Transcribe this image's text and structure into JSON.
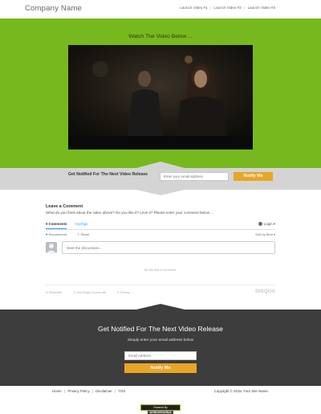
{
  "header": {
    "company_name": "Company Name",
    "nav": [
      "Launch Video #1",
      "Launch Video #2",
      "Launch Video #3"
    ],
    "separator": "|"
  },
  "hero": {
    "title": "Watch The Video Below ...",
    "background_color": "#77b81e"
  },
  "notify_band": {
    "text": "Get Notified For The Next Video Release",
    "email_placeholder": "Enter your email address",
    "button_label": "Notify Me",
    "button_color": "#e8a526"
  },
  "comments": {
    "title": "Leave a Comment",
    "subtitle": "What do you think about the video above? Do you like it? Love it? Please enter your comment below ...",
    "tab_comments": "0 Comments",
    "tab_site": "AnyDigs",
    "login": "Login",
    "recommend": "Recommend",
    "share": "Share",
    "sort": "Sort by Best",
    "input_placeholder": "Start the discussion...",
    "first_comment": "Be the first to comment.",
    "footer_subscribe": "Subscribe",
    "footer_add_disqus": "Add Disqus to your site",
    "footer_privacy": "Privacy",
    "brand": "DISQUS"
  },
  "bottom_signup": {
    "title": "Get Notified For The Next Video Release",
    "subtitle": "Simply enter your email address below",
    "email_placeholder": "Email Address",
    "button_label": "Notify Me"
  },
  "footer": {
    "links": [
      "Home",
      "Privacy Policy",
      "Disclaimer",
      "TOS"
    ],
    "separator": "|",
    "copyright": "Copyright © 2015. Your Site Name.",
    "powered_by": "Powered By",
    "powered_brand": "WORDZEESZRUS"
  }
}
